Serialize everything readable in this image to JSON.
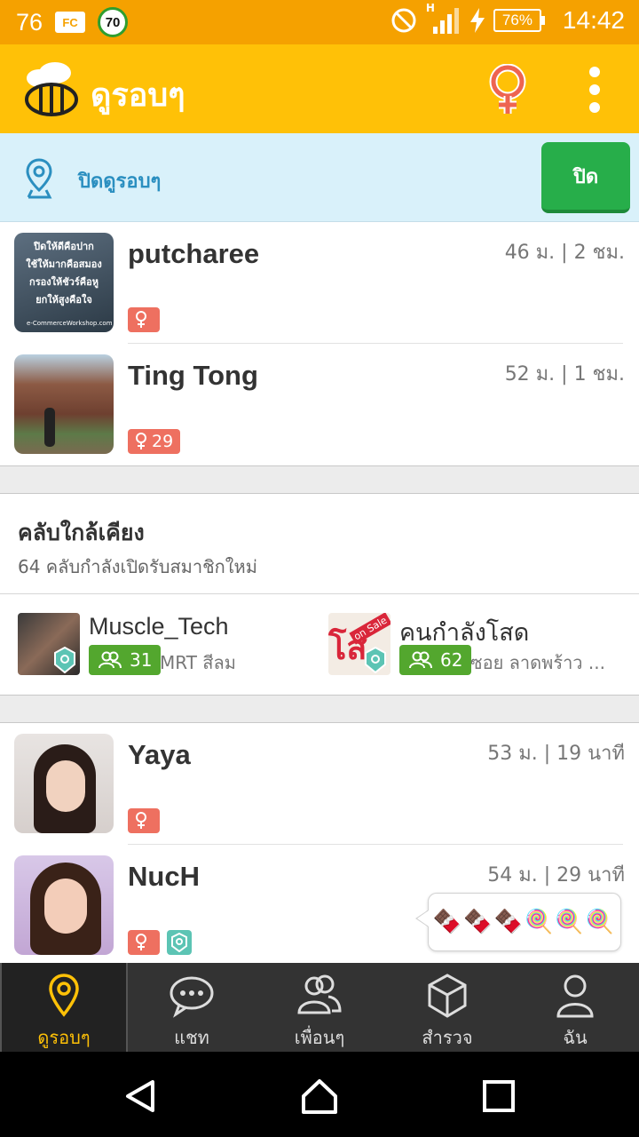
{
  "status_bar": {
    "left_number": "76",
    "fc_label": "FC",
    "speed_badge": "70",
    "network_type": "H",
    "battery_percent": "76%",
    "time": "14:42",
    "icons": [
      "fc-icon",
      "speed-limit-icon",
      "do-not-disturb-icon",
      "signal-icon",
      "charging-icon",
      "battery-icon"
    ]
  },
  "app_bar": {
    "title": "ดูรอบๆ",
    "icons": [
      "beetalk-logo-icon",
      "female-filter-icon",
      "overflow-menu-icon"
    ]
  },
  "banner": {
    "text": "ปิดดูรอบๆ",
    "button_label": "ปิด"
  },
  "users_top": [
    {
      "name": "putcharee",
      "meta": "46 ม. | 2 ชม.",
      "age": "",
      "has_location": false,
      "avatar_lines": [
        "ปิดให้ดีคือปาก",
        "ใช้ให้มากคือสมอง",
        "กรองให้ชัวร์คือหู",
        "ยกให้สูงคือใจ"
      ],
      "avatar_footer": "e-CommerceWorkshop.com"
    },
    {
      "name": "Ting Tong",
      "meta": "52 ม. | 1 ชม.",
      "age": "29",
      "has_location": false
    }
  ],
  "clubs": {
    "title": "คลับใกล้เคียง",
    "subtitle": "64 คลับกำลังเปิดรับสมาชิกใหม่",
    "items": [
      {
        "name": "Muscle_Tech",
        "members": "31",
        "location": "MRT สีลม"
      },
      {
        "name": "คนกำลังโสด",
        "members": "62",
        "location": "ซอย ลาดพร้าว ...",
        "image_text": "โส",
        "image_tag": "on Sale"
      }
    ]
  },
  "users_bottom": [
    {
      "name": "Yaya",
      "meta": "53 ม. | 19 นาที",
      "age": "",
      "has_location": false
    },
    {
      "name": "NucH",
      "meta": "54 ม. | 29 นาที",
      "age": "",
      "has_location": true
    }
  ],
  "chat_bubble": "🍫🍫🍫🍭🍭🍭",
  "bottom_nav": [
    {
      "label": "ดูรอบๆ",
      "icon": "location-pin-icon",
      "active": true
    },
    {
      "label": "แชท",
      "icon": "chat-bubble-icon",
      "active": false
    },
    {
      "label": "เพื่อนๆ",
      "icon": "friends-icon",
      "active": false
    },
    {
      "label": "สำรวจ",
      "icon": "explore-cube-icon",
      "active": false
    },
    {
      "label": "ฉัน",
      "icon": "profile-icon",
      "active": false
    }
  ],
  "system_nav": [
    "back-icon",
    "home-icon",
    "recents-icon"
  ],
  "colors": {
    "status_bar": "#f5a100",
    "app_bar": "#ffc107",
    "banner_bg": "#d9f1fa",
    "close_button": "#27ae4a",
    "gender_badge": "#ee7060",
    "member_badge": "#53a72e",
    "bottom_nav": "#333333",
    "active_tab": "#ffc107"
  }
}
